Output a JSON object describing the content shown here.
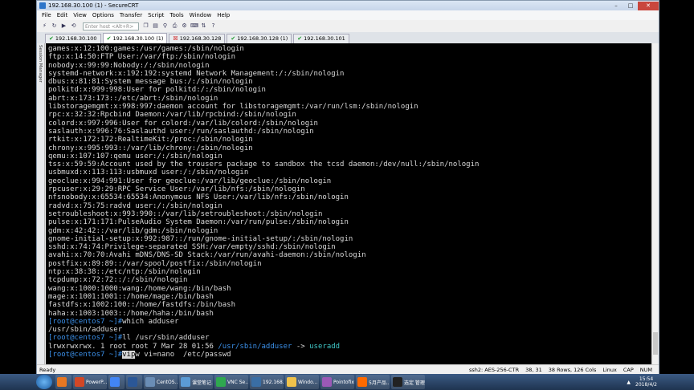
{
  "window": {
    "title": "192.168.30.100 (1) - SecureCRT"
  },
  "menu": [
    "File",
    "Edit",
    "View",
    "Options",
    "Transfer",
    "Script",
    "Tools",
    "Window",
    "Help"
  ],
  "toolbar": {
    "host_placeholder": "Enter host <Alt+R>"
  },
  "tabs": [
    {
      "label": "192.168.30.100",
      "state": "ok"
    },
    {
      "label": "192.168.30.100 (1)",
      "state": "ok",
      "active": true
    },
    {
      "label": "192.168.30.128",
      "state": "error"
    },
    {
      "label": "192.168.30.128 (1)",
      "state": "ok"
    },
    {
      "label": "192.168.30.101",
      "state": "ok"
    }
  ],
  "session_manager_label": "Session Manager",
  "terminal_lines": [
    "games:x:12:100:games:/usr/games:/sbin/nologin",
    "ftp:x:14:50:FTP User:/var/ftp:/sbin/nologin",
    "nobody:x:99:99:Nobody:/:/sbin/nologin",
    "systemd-network:x:192:192:systemd Network Management:/:/sbin/nologin",
    "dbus:x:81:81:System message bus:/:/sbin/nologin",
    "polkitd:x:999:998:User for polkitd:/:/sbin/nologin",
    "abrt:x:173:173::/etc/abrt:/sbin/nologin",
    "libstoragemgmt:x:998:997:daemon account for libstoragemgmt:/var/run/lsm:/sbin/nologin",
    "rpc:x:32:32:Rpcbind Daemon:/var/lib/rpcbind:/sbin/nologin",
    "colord:x:997:996:User for colord:/var/lib/colord:/sbin/nologin",
    "saslauth:x:996:76:Saslauthd user:/run/saslauthd:/sbin/nologin",
    "rtkit:x:172:172:RealtimeKit:/proc:/sbin/nologin",
    "chrony:x:995:993::/var/lib/chrony:/sbin/nologin",
    "qemu:x:107:107:qemu user:/:/sbin/nologin",
    "tss:x:59:59:Account used by the trousers package to sandbox the tcsd daemon:/dev/null:/sbin/nologin",
    "usbmuxd:x:113:113:usbmuxd user:/:/sbin/nologin",
    "geoclue:x:994:991:User for geoclue:/var/lib/geoclue:/sbin/nologin",
    "rpcuser:x:29:29:RPC Service User:/var/lib/nfs:/sbin/nologin",
    "nfsnobody:x:65534:65534:Anonymous NFS User:/var/lib/nfs:/sbin/nologin",
    "radvd:x:75:75:radvd user:/:/sbin/nologin",
    "setroubleshoot:x:993:990::/var/lib/setroubleshoot:/sbin/nologin",
    "pulse:x:171:171:PulseAudio System Daemon:/var/run/pulse:/sbin/nologin",
    "gdm:x:42:42::/var/lib/gdm:/sbin/nologin",
    "gnome-initial-setup:x:992:987::/run/gnome-initial-setup/:/sbin/nologin",
    "sshd:x:74:74:Privilege-separated SSH:/var/empty/sshd:/sbin/nologin",
    "avahi:x:70:70:Avahi mDNS/DNS-SD Stack:/var/run/avahi-daemon:/sbin/nologin",
    "postfix:x:89:89::/var/spool/postfix:/sbin/nologin",
    "ntp:x:38:38::/etc/ntp:/sbin/nologin",
    "tcpdump:x:72:72::/:/sbin/nologin",
    "wang:x:1000:1000:wang:/home/wang:/bin/bash",
    "mage:x:1001:1001::/home/mage:/bin/bash",
    "fastdfs:x:1002:100::/home/fastdfs:/bin/bash",
    "haha:x:1003:1003::/home/haha:/bin/bash"
  ],
  "cmd1": {
    "prompt": "[root@centos7 ~]#",
    "command": "which adduser"
  },
  "cmd1_output": "/usr/sbin/adduser",
  "cmd2": {
    "prompt": "[root@centos7 ~]#",
    "command": "ll /usr/sbin/adduser"
  },
  "cmd2_output": {
    "prefix": "lrwxrwxrwx. 1 root root 7 Mar 28 01:56 ",
    "path": "/usr/sbin/adduser",
    "arrow": " -> ",
    "target": "useradd"
  },
  "cmd3": {
    "prompt": "[root@centos7 ~]#",
    "selected": "vip",
    "rest": "w vi=nano  /etc/passwd"
  },
  "status": {
    "left": "Ready",
    "ssh": "ssh2: AES-256-CTR",
    "pos": "38, 31",
    "size": "38 Rows, 126 Cols",
    "term": "Linux",
    "caps": "CAP",
    "num": "NUM"
  },
  "taskbar": {
    "items": [
      {
        "label": "",
        "color": "#e87722",
        "small": true
      },
      {
        "label": "PowerP...",
        "color": "#d24726"
      },
      {
        "label": "",
        "color": "#4285f4",
        "small": true
      },
      {
        "label": "",
        "color": "#2b5797",
        "small": true
      },
      {
        "label": "CentOS...",
        "color": "#6a8db5"
      },
      {
        "label": "课堂笔记...",
        "color": "#5b9bd5"
      },
      {
        "label": "VNC Se...",
        "color": "#2fa84f"
      },
      {
        "label": "192.168...",
        "color": "#3a6ea5"
      },
      {
        "label": "Windo...",
        "color": "#f0c24b"
      },
      {
        "label": "Pointofix",
        "color": "#9b59b6"
      },
      {
        "label": "5月产品...",
        "color": "#ff6a00"
      },
      {
        "label": "选定 管理...",
        "color": "#222"
      }
    ],
    "time": "15:54",
    "date": "2018/4/2"
  }
}
